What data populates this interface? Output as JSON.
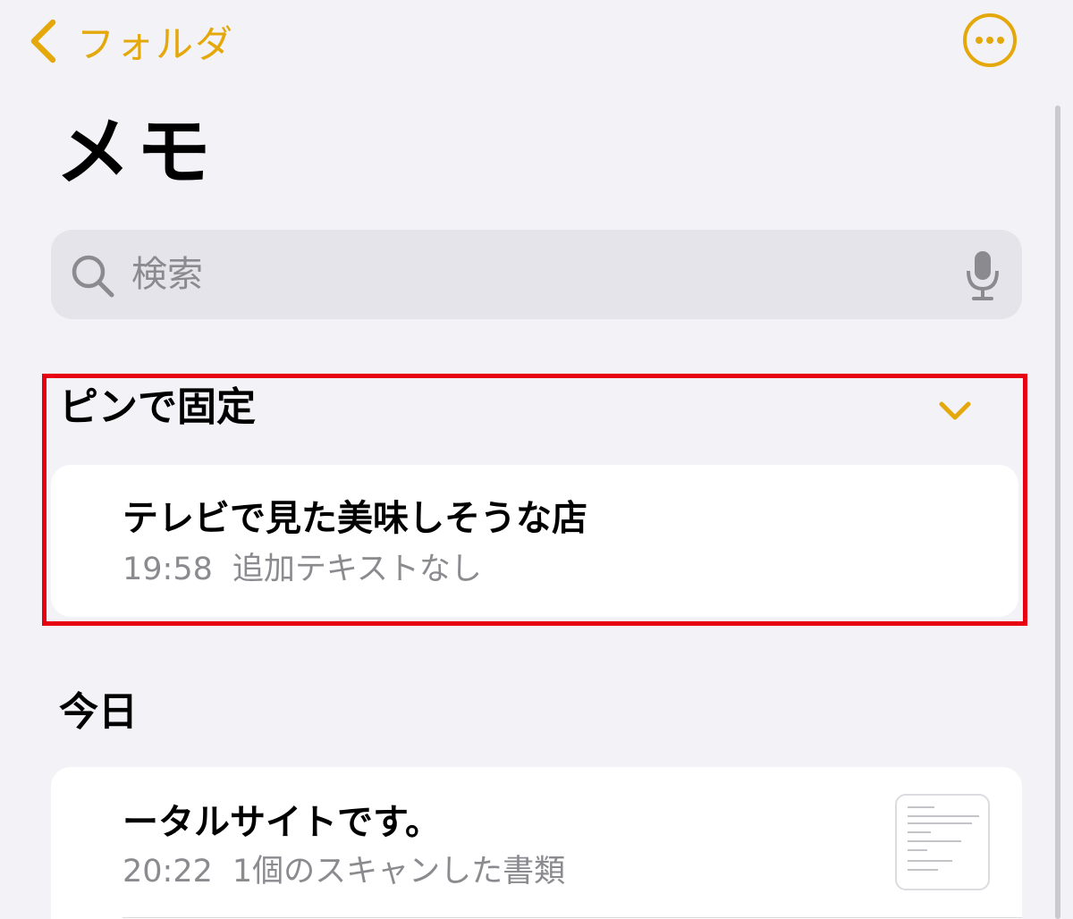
{
  "nav": {
    "back_label": "フォルダ",
    "accent_color": "#e5a80a"
  },
  "page": {
    "title": "メモ"
  },
  "search": {
    "placeholder": "検索"
  },
  "pinned": {
    "header": "ピンで固定",
    "highlight_color": "#e60012",
    "notes": [
      {
        "title": "テレビで見た美味しそうな店",
        "time": "19:58",
        "preview": "追加テキストなし"
      }
    ]
  },
  "today": {
    "header": "今日",
    "notes": [
      {
        "title": "ータルサイトです。",
        "time": "20:22",
        "preview": "1個のスキャンした書類",
        "thumbnail": "scanned-document"
      }
    ]
  },
  "icons": {
    "back": "chevron-left-icon",
    "more": "ellipsis-circle-icon",
    "search": "magnifier-icon",
    "mic": "microphone-icon",
    "collapse": "chevron-down-icon"
  }
}
